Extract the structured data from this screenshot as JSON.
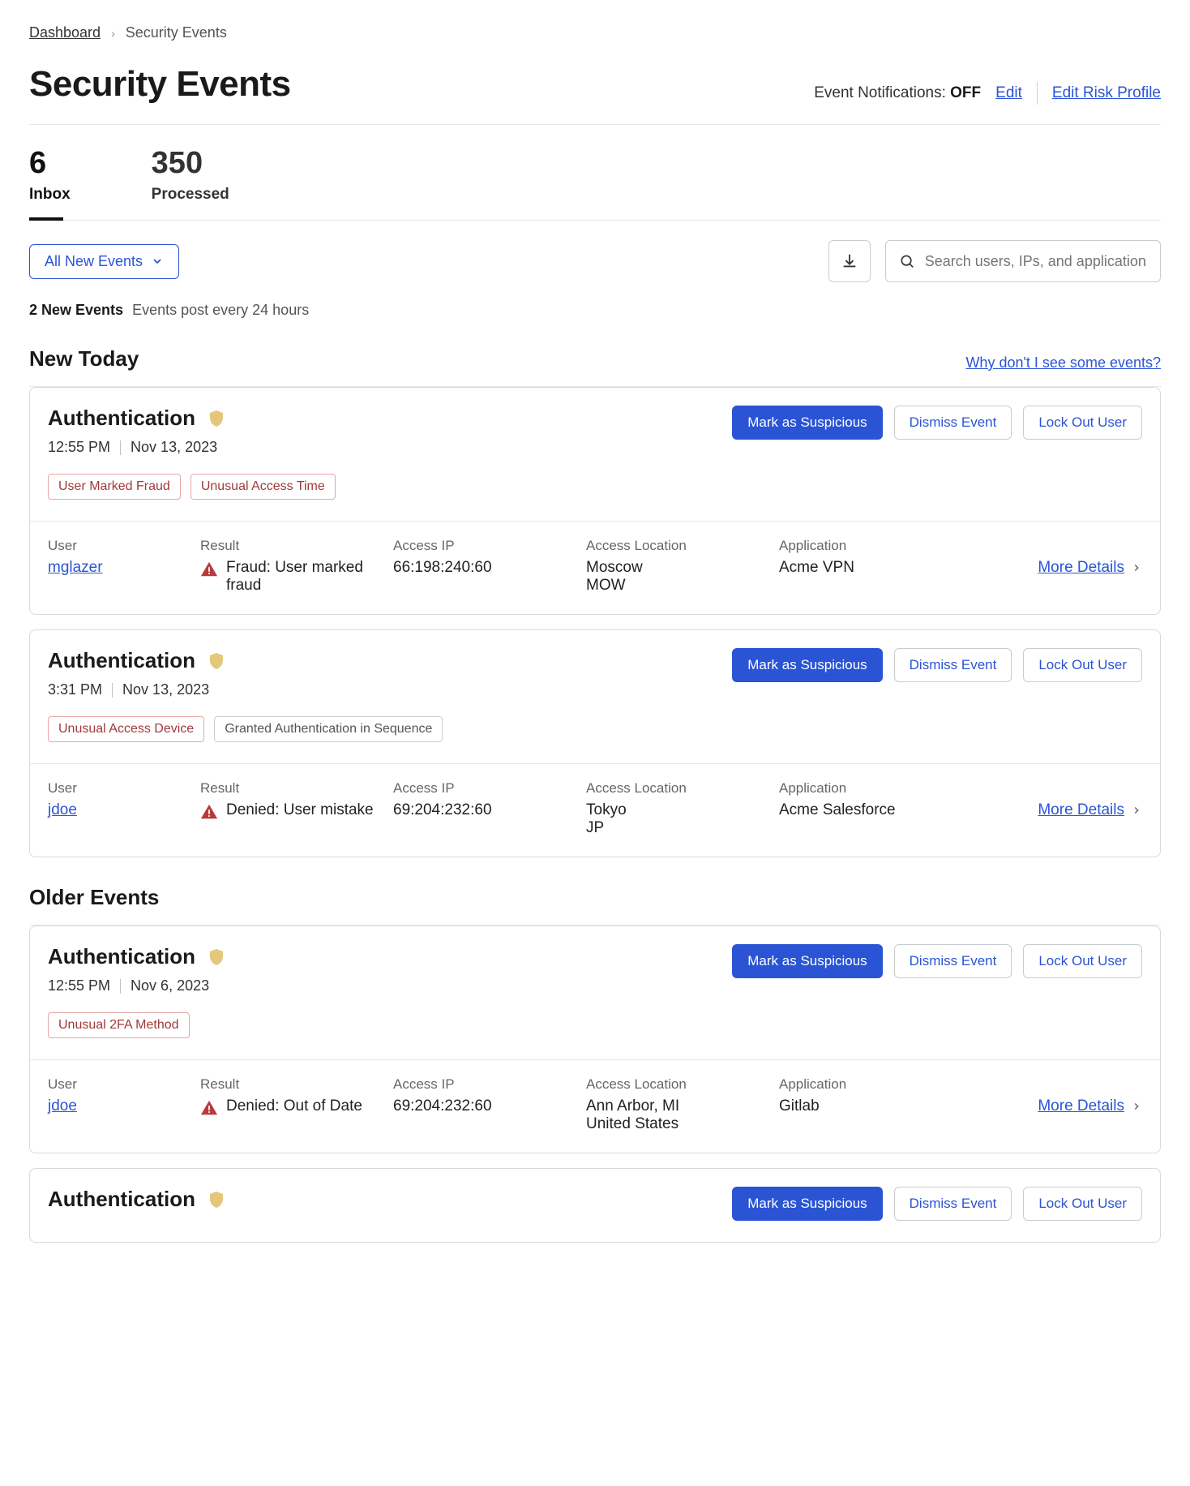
{
  "breadcrumb": {
    "root": "Dashboard",
    "leaf": "Security Events"
  },
  "page_title": "Security Events",
  "header": {
    "notif_label": "Event Notifications: ",
    "notif_state": "OFF",
    "edit": "Edit",
    "edit_risk": "Edit Risk Profile"
  },
  "tabs": {
    "inbox": {
      "count": "6",
      "label": "Inbox"
    },
    "processed": {
      "count": "350",
      "label": "Processed"
    }
  },
  "filter_label": "All New Events",
  "search_placeholder": "Search users, IPs, and applications",
  "postline": {
    "count": "2 New Events",
    "sub": "Events post every 24 hours"
  },
  "sections": {
    "new": {
      "title": "New Today",
      "help": "Why don't I see some events?"
    },
    "older": {
      "title": "Older Events"
    }
  },
  "btn": {
    "mark": "Mark as Suspicious",
    "dismiss": "Dismiss Event",
    "lockout": "Lock Out User",
    "more": "More Details"
  },
  "col": {
    "user": "User",
    "result": "Result",
    "ip": "Access IP",
    "loc": "Access Location",
    "app": "Application"
  },
  "events": [
    {
      "title": "Authentication",
      "time": "12:55 PM",
      "date": "Nov 13, 2023",
      "tags": [
        "User Marked Fraud",
        "Unusual Access Time"
      ],
      "tag_styles": [
        "alert",
        "alert"
      ],
      "user": "mglazer",
      "result": "Fraud: User marked fraud",
      "ip": "66:198:240:60",
      "loc1": "Moscow",
      "loc2": "MOW",
      "app": "Acme VPN"
    },
    {
      "title": "Authentication",
      "time": "3:31 PM",
      "date": "Nov 13, 2023",
      "tags": [
        "Unusual Access Device",
        "Granted Authentication in Sequence"
      ],
      "tag_styles": [
        "alert",
        "neutral"
      ],
      "user": "jdoe",
      "result": "Denied: User mistake",
      "ip": "69:204:232:60",
      "loc1": "Tokyo",
      "loc2": "JP",
      "app": "Acme Salesforce"
    },
    {
      "title": "Authentication",
      "time": "12:55 PM",
      "date": "Nov 6, 2023",
      "tags": [
        "Unusual 2FA Method"
      ],
      "tag_styles": [
        "alert"
      ],
      "user": "jdoe",
      "result": "Denied: Out of Date",
      "ip": "69:204:232:60",
      "loc1": "Ann Arbor, MI",
      "loc2": "United States",
      "app": "Gitlab"
    },
    {
      "title": "Authentication",
      "time": "",
      "date": "",
      "tags": [],
      "tag_styles": [],
      "user": "",
      "result": "",
      "ip": "",
      "loc1": "",
      "loc2": "",
      "app": ""
    }
  ]
}
